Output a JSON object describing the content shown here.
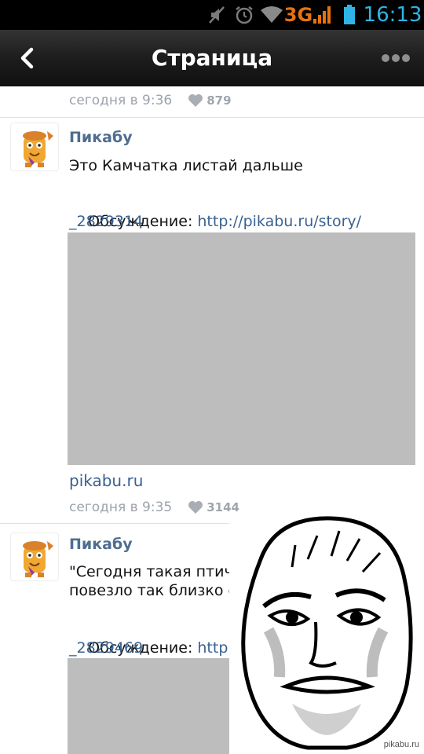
{
  "status_bar": {
    "network": "3G",
    "time": "16:13",
    "icons": [
      "mute-icon",
      "alarm-icon",
      "wifi-icon",
      "signal-icon",
      "battery-icon"
    ]
  },
  "nav": {
    "title": "Страница",
    "back_icon": "chevron-left-icon",
    "more_icon": "more-dots-icon"
  },
  "posts": [
    {
      "time": "сегодня в 9:36",
      "likes": "879"
    },
    {
      "author": "Пикабу",
      "text": "Это Камчатка листай дальше",
      "discussion_label": "Обсуждение: ",
      "discussion_link_1": "http://pikabu.ru/story/",
      "discussion_link_2": "_2829314",
      "source": "pikabu.ru",
      "time": "сегодня в 9:35",
      "likes": "3144"
    },
    {
      "author": "Пикабу",
      "text_line_1": "\"Сегодня такая птич",
      "text_line_2": "повезло так близко с",
      "discussion_label": "Обсуждение: ",
      "discussion_link_1": "http://p",
      "discussion_link_2": "_2829469"
    }
  ],
  "watermark": "pikabu.ru",
  "colors": {
    "author": "#4e6d91",
    "link": "#3a6190",
    "meta": "#9da3ab",
    "network": "#e8720c",
    "time": "#2fb4e6"
  }
}
